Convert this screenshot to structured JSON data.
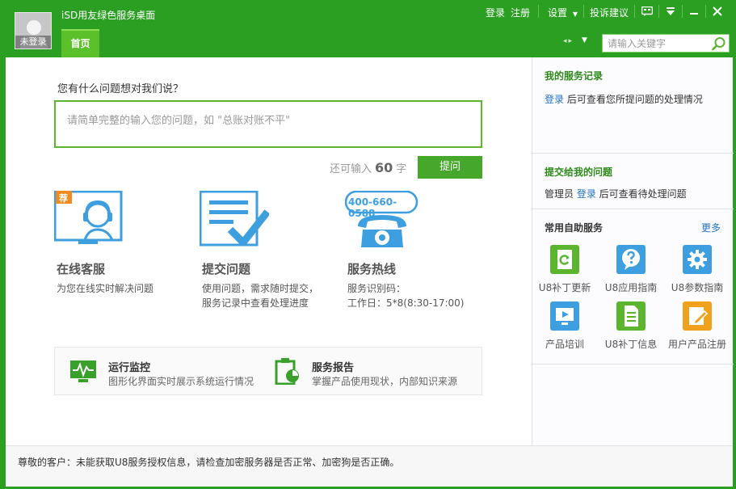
{
  "app": {
    "title": "iSD用友绿色服务桌面",
    "avatar_label": "未登录",
    "tab_home": "首页"
  },
  "topbar": {
    "login": "登录",
    "register": "注册",
    "settings": "设置",
    "complaint": "投诉建议",
    "search_placeholder": "请输入关键字"
  },
  "ask": {
    "title": "您有什么问题想对我们说？",
    "placeholder": "请简单完整的输入您的问题，如 \"总账对账不平\"",
    "remain_prefix": "还可输入",
    "remain_count": "60",
    "remain_suffix": "字",
    "button": "提问"
  },
  "services": [
    {
      "badge": "荐",
      "title": "在线客服",
      "desc1": "为您在线实时解决问题",
      "desc2": ""
    },
    {
      "title": "提交问题",
      "desc1": "使用问题，需求随时提交，",
      "desc2": "服务记录中查看处理进度"
    },
    {
      "phone": "400-660-0588",
      "title": "服务热线",
      "desc1": "服务识别码：",
      "desc2": "工作日：5*8(8:30-17:00)"
    }
  ],
  "tools": [
    {
      "title": "运行监控",
      "desc": "图形化界面实时展示系统运行情况"
    },
    {
      "title": "服务报告",
      "desc": "掌握产品使用现状，内部知识来源"
    }
  ],
  "status": "尊敬的客户：未能获取U8服务授权信息，请检查加密服务器是否正常、加密狗是否正确。",
  "right": {
    "records": {
      "title": "我的服务记录",
      "login": "登录",
      "text": " 后可查看您所提问题的处理情况"
    },
    "submitted": {
      "title": "提交给我的问题",
      "prefix": "管理员 ",
      "login": "登录",
      "text": " 后可查看待处理问题"
    },
    "self_service": {
      "title": "常用自助服务",
      "more": "更多",
      "items": [
        {
          "label": "U8补丁更新",
          "color": "#5cb52f",
          "icon": "patch-update-icon"
        },
        {
          "label": "U8应用指南",
          "color": "#3d9fe0",
          "icon": "help-guide-icon"
        },
        {
          "label": "U8参数指南",
          "color": "#3d9fe0",
          "icon": "gear-icon"
        },
        {
          "label": "产品培训",
          "color": "#3d9fe0",
          "icon": "training-icon"
        },
        {
          "label": "U8补丁信息",
          "color": "#5cb52f",
          "icon": "document-icon"
        },
        {
          "label": "用户产品注册",
          "color": "#f0a21c",
          "icon": "register-icon"
        }
      ]
    }
  }
}
